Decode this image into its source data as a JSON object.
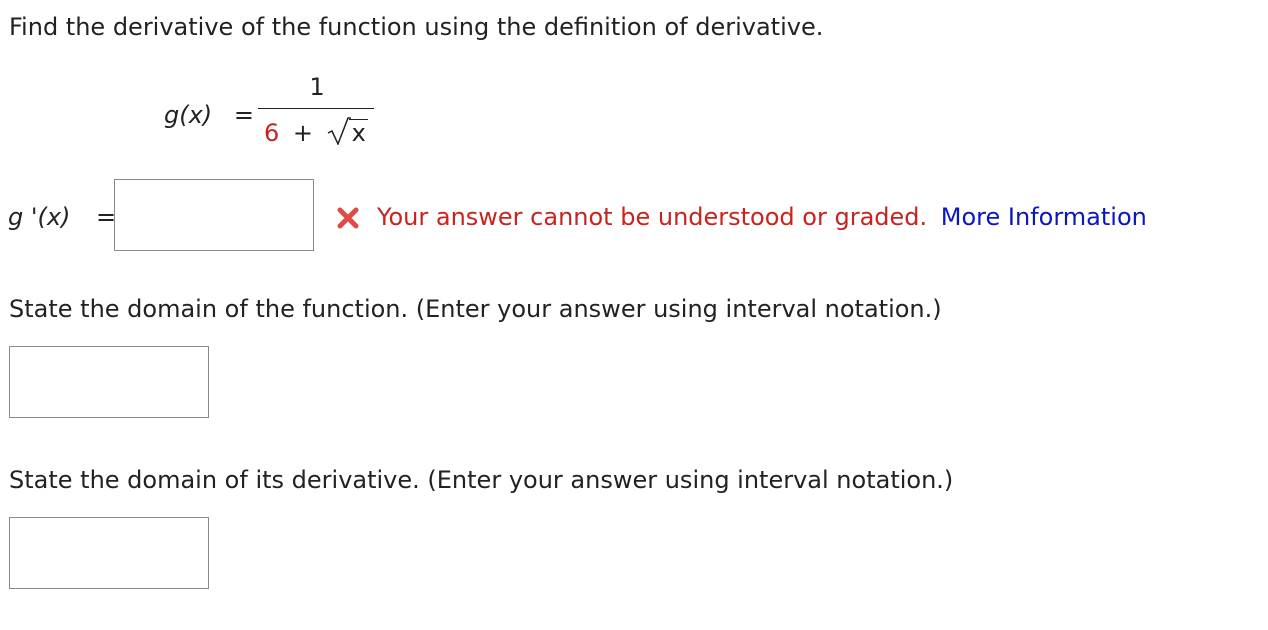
{
  "question": {
    "instruction": "Find the derivative of the function using the definition of derivative.",
    "function_lhs": "g(x)",
    "equals": "=",
    "numerator": "1",
    "denominator_constant": "6",
    "denominator_plus": "+",
    "radicand": "x"
  },
  "derivative_answer": {
    "label": "g '(x)",
    "equals": "=",
    "value": "",
    "status_icon": "red-x-icon",
    "feedback_text": "Your answer cannot be understood or graded.",
    "more_info_link": "More Information"
  },
  "domain_function": {
    "prompt": "State the domain of the function. (Enter your answer using interval notation.)",
    "value": ""
  },
  "domain_derivative": {
    "prompt": "State the domain of its derivative. (Enter your answer using interval notation.)",
    "value": ""
  },
  "colors": {
    "error_red": "#c8231e",
    "link_blue": "#0a16c2",
    "text": "#222222",
    "input_border": "#8a8a8a"
  }
}
